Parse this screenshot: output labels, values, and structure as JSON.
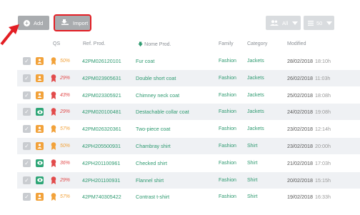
{
  "toolbar": {
    "add_label": "Add",
    "import_label": "Import",
    "filter_all_label": "All",
    "per_page_label": "50"
  },
  "columns": {
    "qs": "QS",
    "ref": "Ref. Prod.",
    "name": "Nome Prod.",
    "family": "Family",
    "category": "Category",
    "modified": "Modified"
  },
  "colors": {
    "accent_green": "#2e9a70",
    "warn_orange": "#f2a23a",
    "bad_red": "#e24b4b",
    "highlight_red": "#e31e24"
  },
  "rows": [
    {
      "status": "warn",
      "qs": "50%",
      "qs_level": "mid",
      "ref": "42PM026120101",
      "name": "Fur coat",
      "family": "Fashion",
      "category": "Jackets",
      "date": "28/02/2018",
      "time": "18:10h"
    },
    {
      "status": "warn",
      "qs": "29%",
      "qs_level": "low",
      "ref": "42PM023905631",
      "name": "Double short coat",
      "family": "Fashion",
      "category": "Jackets",
      "date": "26/02/2018",
      "time": "11:03h"
    },
    {
      "status": "warn",
      "qs": "43%",
      "qs_level": "low",
      "ref": "42PM023305921",
      "name": "Chimney neck coat",
      "family": "Fashion",
      "category": "Jackets",
      "date": "25/02/2018",
      "time": "18:08h"
    },
    {
      "status": "eye",
      "qs": "29%",
      "qs_level": "low",
      "ref": "42PM020100481",
      "name": "Destachable collar coat",
      "family": "Fashion",
      "category": "Jackets",
      "date": "24/02/2018",
      "time": "19:08h"
    },
    {
      "status": "warn",
      "qs": "57%",
      "qs_level": "mid",
      "ref": "42PM026320361",
      "name": "Two-piece coat",
      "family": "Fashion",
      "category": "Jackets",
      "date": "23/02/2018",
      "time": "12:14h"
    },
    {
      "status": "warn",
      "qs": "50%",
      "qs_level": "mid",
      "ref": "42PH205500931",
      "name": "Chambray shirt",
      "family": "Fashion",
      "category": "Shirt",
      "date": "23/02/2018",
      "time": "20:00h"
    },
    {
      "status": "eye",
      "qs": "36%",
      "qs_level": "low",
      "ref": "42PH201100961",
      "name": "Checked shirt",
      "family": "Fashion",
      "category": "Shirt",
      "date": "21/02/2018",
      "time": "17:03h"
    },
    {
      "status": "eye",
      "qs": "29%",
      "qs_level": "low",
      "ref": "42PH201100931",
      "name": "Flannel shirt",
      "family": "Fashion",
      "category": "Shirt",
      "date": "20/02/2018",
      "time": "15:15h"
    },
    {
      "status": "warn",
      "qs": "57%",
      "qs_level": "mid",
      "ref": "42PM740305422",
      "name": "Contrast t-shirt",
      "family": "Fashion",
      "category": "Shirt",
      "date": "19/02/2018",
      "time": "16:33h"
    }
  ]
}
